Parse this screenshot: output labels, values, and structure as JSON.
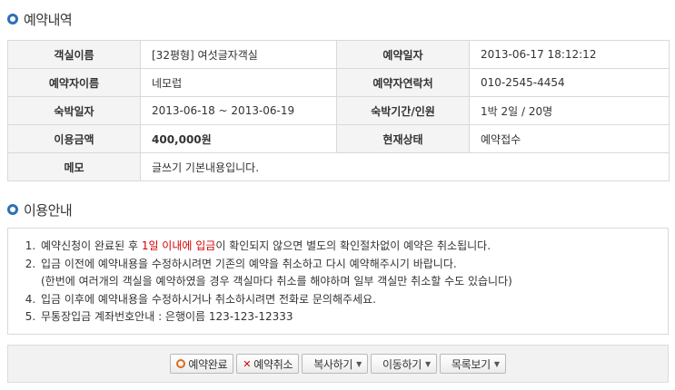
{
  "reservation": {
    "title": "예약내역",
    "rows": [
      {
        "label1": "객실이름",
        "value1": "[32평형] 여섯글자객실",
        "label2": "예약일자",
        "value2": "2013-06-17 18:12:12"
      },
      {
        "label1": "예약자이름",
        "value1": "네모럽",
        "label2": "예약자연락처",
        "value2": "010-2545-4454"
      },
      {
        "label1": "숙박일자",
        "value1": "2013-06-18 ~ 2013-06-19",
        "label2": "숙박기간/인원",
        "value2": "1박 2일 / 20명"
      },
      {
        "label1": "이용금액",
        "value1": "400,000원",
        "label2": "현재상태",
        "value2": "예약접수"
      }
    ],
    "memo_label": "메모",
    "memo_value": "글쓰기 기본내용입니다."
  },
  "guide": {
    "title": "이용안내",
    "item1_prefix": "예약신청이 완료된 후 ",
    "item1_highlight": "1일 이내에 입금",
    "item1_suffix": "이 확인되지 않으면 별도의 확인절차없이 예약은 취소됩니다.",
    "item2": "입금 이전에 예약내용을 수정하시려면 기존의 예약을 취소하고 다시 예약해주시기 바랍니다.",
    "item2_note": "(한번에 여러개의 객실을 예약하였을 경우 객실마다 취소를 해야하며 일부 객실만 취소할 수도 있습니다)",
    "item3": "입금 이후에 예약내용을 수정하시거나 취소하시려면 전화로 문의해주세요.",
    "item4": "무통장입금 계좌번호안내 : 은행이름 123-123-12333"
  },
  "buttons": {
    "complete": "예약완료",
    "cancel": "예약취소",
    "copy": "복사하기",
    "move": "이동하기",
    "list": "목록보기"
  },
  "colors": {
    "accent_blue": "#2e6fb7",
    "highlight_red": "#d40000",
    "header_bg": "#f4f4f4"
  }
}
